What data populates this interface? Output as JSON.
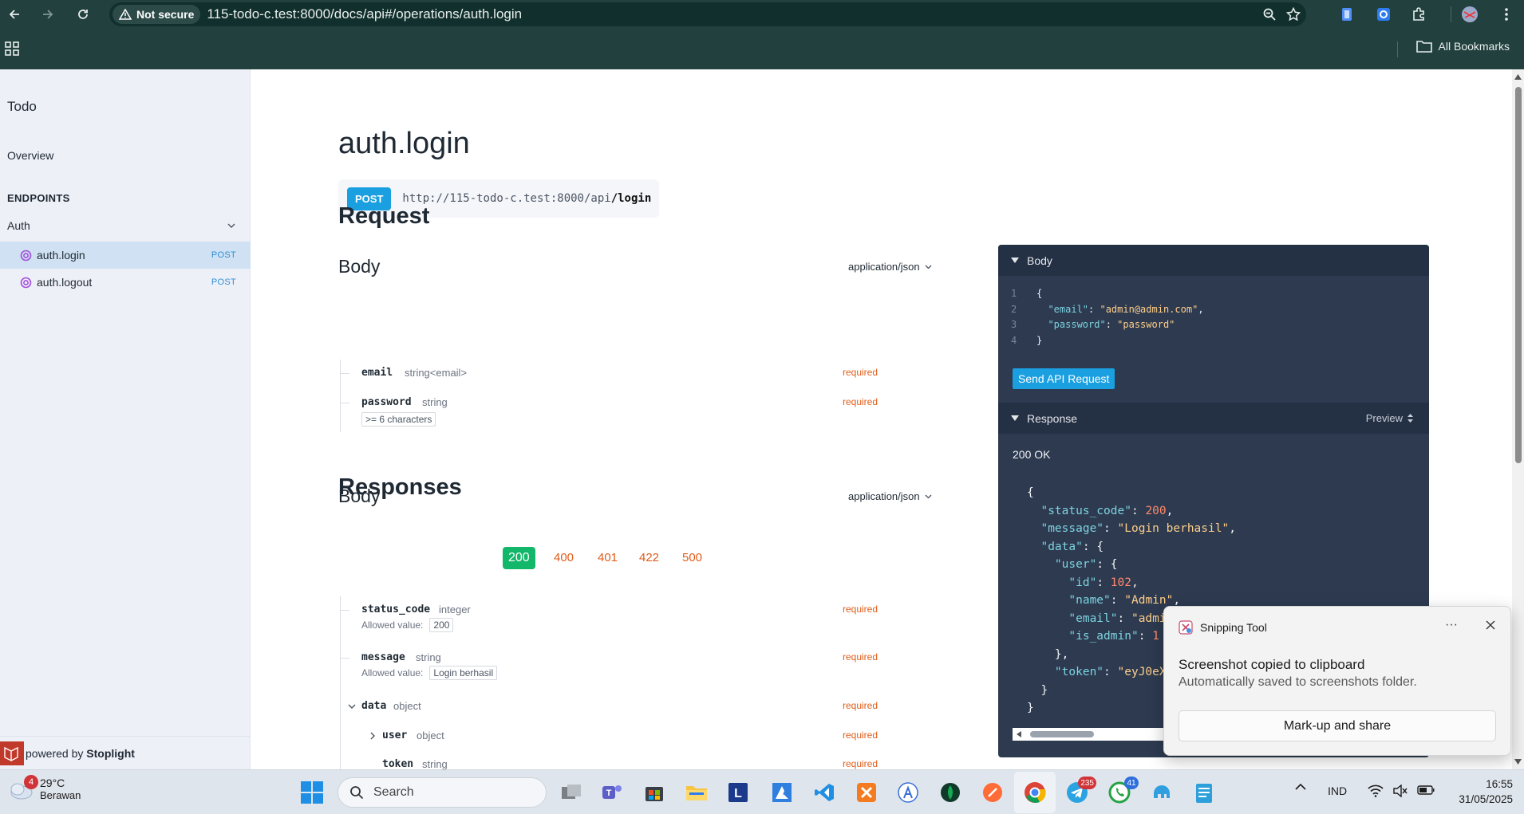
{
  "browser": {
    "security_label": "Not secure",
    "url": "115-todo-c.test:8000/docs/api#/operations/auth.login",
    "bookmarks_label": "All Bookmarks"
  },
  "sidebar": {
    "title": "Todo",
    "overview": "Overview",
    "section": "ENDPOINTS",
    "group": "Auth",
    "items": [
      {
        "label": "auth.login",
        "method": "POST"
      },
      {
        "label": "auth.logout",
        "method": "POST"
      }
    ],
    "footer_prefix": "powered by ",
    "footer_brand": "Stoplight"
  },
  "main": {
    "title": "auth.login",
    "method": "POST",
    "url_base": "http://115-todo-c.test:8000/api",
    "url_path": "/login",
    "request_heading": "Request",
    "body_heading": "Body",
    "content_type": "application/json",
    "request_props": [
      {
        "name": "email",
        "type": "string<email>",
        "req": "required"
      },
      {
        "name": "password",
        "type": "string",
        "req": "required",
        "constraint": ">= 6 characters"
      }
    ],
    "responses_heading": "Responses",
    "response_codes": [
      "200",
      "400",
      "401",
      "422",
      "500"
    ],
    "response_body_heading": "Body",
    "response_content_type": "application/json",
    "allowed_label": "Allowed value:",
    "response_props": [
      {
        "name": "status_code",
        "type": "integer",
        "req": "required",
        "allowed": "200"
      },
      {
        "name": "message",
        "type": "string",
        "req": "required",
        "allowed": "Login berhasil"
      },
      {
        "name": "data",
        "type": "object",
        "req": "required"
      },
      {
        "name": "user",
        "type": "object",
        "req": "required"
      },
      {
        "name": "token",
        "type": "string",
        "req": "required"
      }
    ]
  },
  "panel": {
    "body_label": "Body",
    "code_lines": [
      {
        "n": "1",
        "t": "{"
      },
      {
        "n": "2",
        "k": "\"email\"",
        "v": "\"admin@admin.com\"",
        "end": ","
      },
      {
        "n": "3",
        "k": "\"password\"",
        "v": "\"password\"",
        "end": ""
      },
      {
        "n": "4",
        "t": "}"
      }
    ],
    "send_button": "Send API Request",
    "response_label": "Response",
    "preview_label": "Preview",
    "status": "200 OK",
    "response_json": {
      "status_code_key": "\"status_code\"",
      "status_code_val": "200",
      "message_key": "\"message\"",
      "message_val": "\"Login berhasil\"",
      "data_key": "\"data\"",
      "user_key": "\"user\"",
      "id_key": "\"id\"",
      "id_val": "102",
      "name_key": "\"name\"",
      "name_val": "\"Admin\"",
      "email_key": "\"email\"",
      "email_val": "\"admin",
      "is_admin_key": "\"is_admin\"",
      "is_admin_val": "1",
      "token_key": "\"token\"",
      "token_val": "\"eyJ0eXA"
    }
  },
  "toast": {
    "app": "Snipping Tool",
    "more": "···",
    "title": "Screenshot copied to clipboard",
    "subtitle": "Automatically saved to screenshots folder.",
    "action": "Mark-up and share"
  },
  "taskbar": {
    "weather_badge": "4",
    "temperature": "29°C",
    "condition": "Berawan",
    "search_placeholder": "Search",
    "telegram_badge": "235",
    "whatsapp_badge": "41",
    "language": "IND",
    "time": "16:55",
    "date": "31/05/2025"
  },
  "colors": {
    "chrome": "#22403e",
    "accent_blue": "#1a9fe0",
    "required": "#e05d1a",
    "success": "#12b76a",
    "panel": "#2d3a50"
  }
}
